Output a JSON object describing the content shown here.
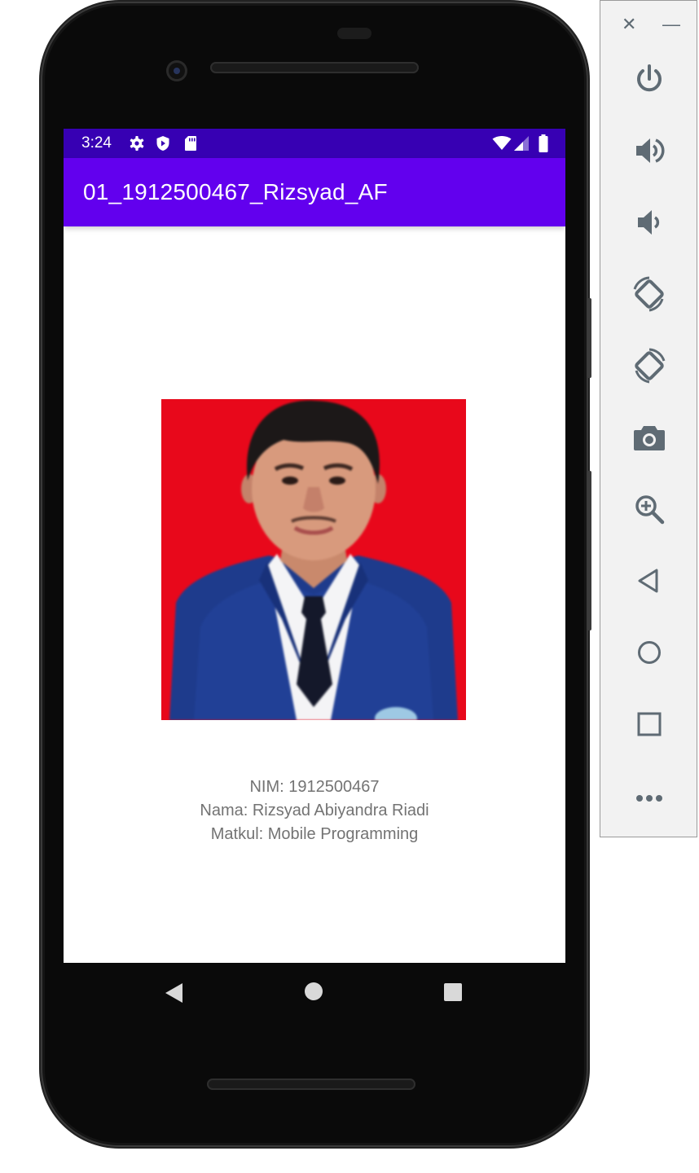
{
  "status_bar": {
    "time": "3:24",
    "background": "#3700b3"
  },
  "app_bar": {
    "title": "01_1912500467_Rizsyad_AF",
    "background": "#6200ee"
  },
  "profile": {
    "photo_alt": "Profile photo",
    "nim": "NIM: 1912500467",
    "nama": "Nama: Rizsyad Abiyandra Riadi",
    "matkul": "Matkul: Mobile Programming"
  },
  "nav_bar": {
    "buttons": [
      "back",
      "home",
      "recents"
    ]
  },
  "emulator_toolbar": {
    "close_label": "✕",
    "minimize_label": "—",
    "buttons": [
      "power-icon",
      "volume-up-icon",
      "volume-down-icon",
      "rotate-left-icon",
      "rotate-right-icon",
      "camera-icon",
      "zoom-icon",
      "back-icon",
      "home-icon",
      "overview-icon",
      "more-icon"
    ],
    "icon_color": "#5f6b74"
  }
}
